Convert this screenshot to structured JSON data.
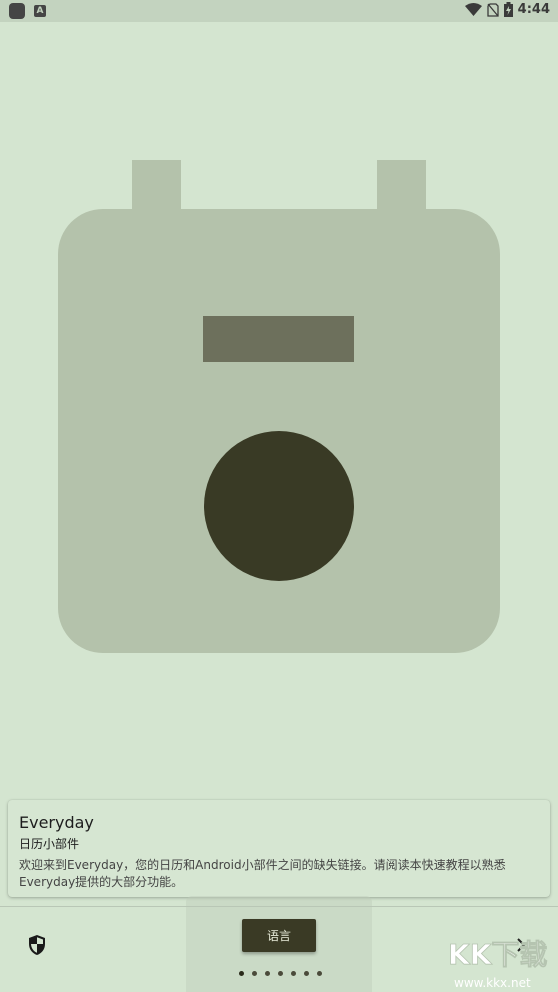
{
  "status_bar": {
    "time": "4:44",
    "left_icons": [
      "app-notification-icon",
      "a-letter-icon"
    ],
    "right_icons": [
      "wifi-icon",
      "no-sim-icon",
      "battery-charging-icon"
    ]
  },
  "illustration": {
    "icon": "calendar-icon",
    "colors": {
      "calendar_body": "#b4c2ab",
      "bar": "#6d705c",
      "circle": "#393a25"
    }
  },
  "card": {
    "title": "Everyday",
    "subtitle": "日历小部件",
    "body": "欢迎来到Everyday，您的日历和Android小部件之间的缺失链接。请阅读本快速教程以熟悉Everyday提供的大部分功能。"
  },
  "bottom_bar": {
    "language_label": "语言",
    "left_icon": "shield-icon",
    "right_icon": "chevron-right-icon",
    "page_indicator": {
      "total": 7,
      "current": 1
    }
  },
  "watermark": {
    "text": "KK下载",
    "url_text": "www.kkx.net"
  },
  "colors": {
    "background": "#d4e5d0",
    "button": "#3a3a25"
  }
}
